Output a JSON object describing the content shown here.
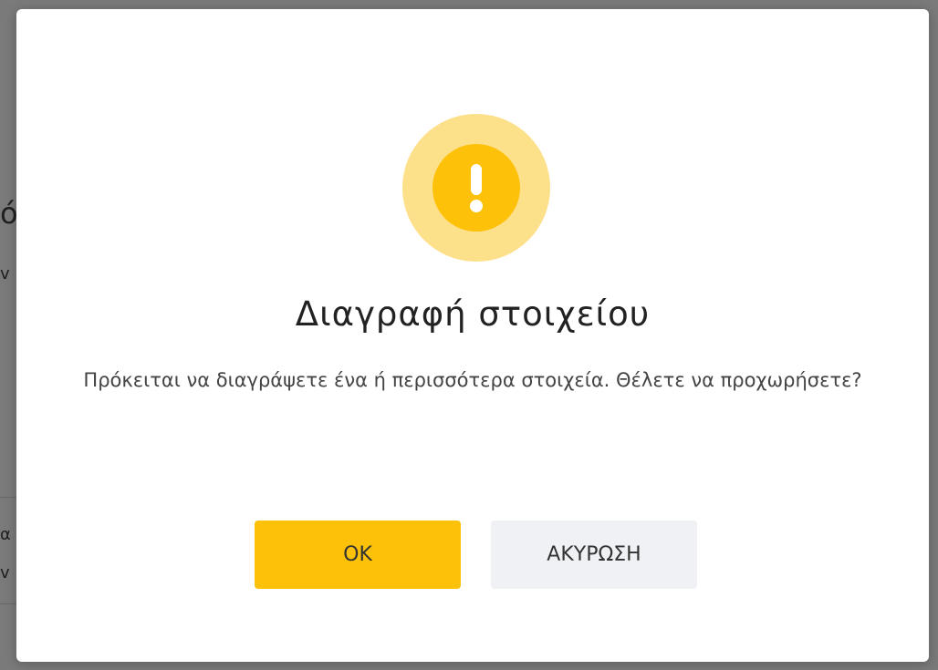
{
  "dialog": {
    "title": "Διαγραφή στοιχείου",
    "message": "Πρόκειται να διαγράψετε ένα ή περισσότερα στοιχεία. Θέλετε να προχωρήσετε?",
    "icon": "warning-exclamation-icon",
    "ok_label": "OK",
    "cancel_label": "ΑΚΥΡΩΣΗ"
  },
  "colors": {
    "accent": "#fdc10a",
    "accent_light": "#fde08a",
    "cancel_bg": "#eff1f4",
    "overlay": "#7a7a7a"
  }
}
